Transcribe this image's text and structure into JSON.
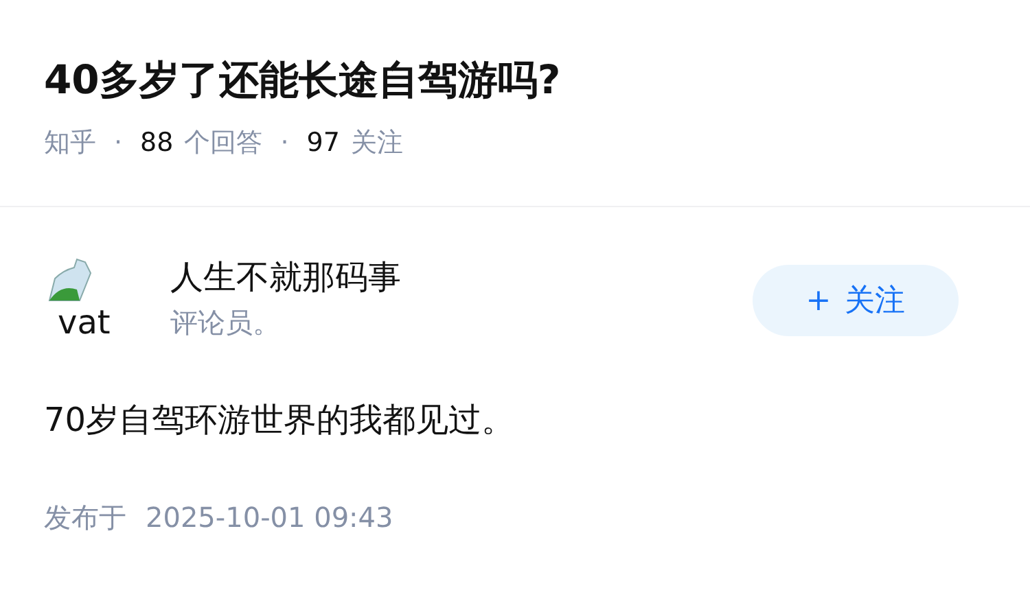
{
  "question": {
    "title": "40多岁了还能长途自驾游吗?",
    "source": "知乎",
    "separators": [
      "·",
      "·"
    ],
    "answer_count": "88",
    "answer_label": "个回答",
    "follower_count": "97",
    "follower_label": "关注"
  },
  "answer": {
    "author": {
      "avatar_alt": "vat",
      "name": "人生不就那码事",
      "headline": "评论员。"
    },
    "follow_button": {
      "icon": "+",
      "label": "关注"
    },
    "content": "70岁自驾环游世界的我都见过。",
    "published_label": "发布于",
    "published_time": "2025-10-01 09:43"
  }
}
